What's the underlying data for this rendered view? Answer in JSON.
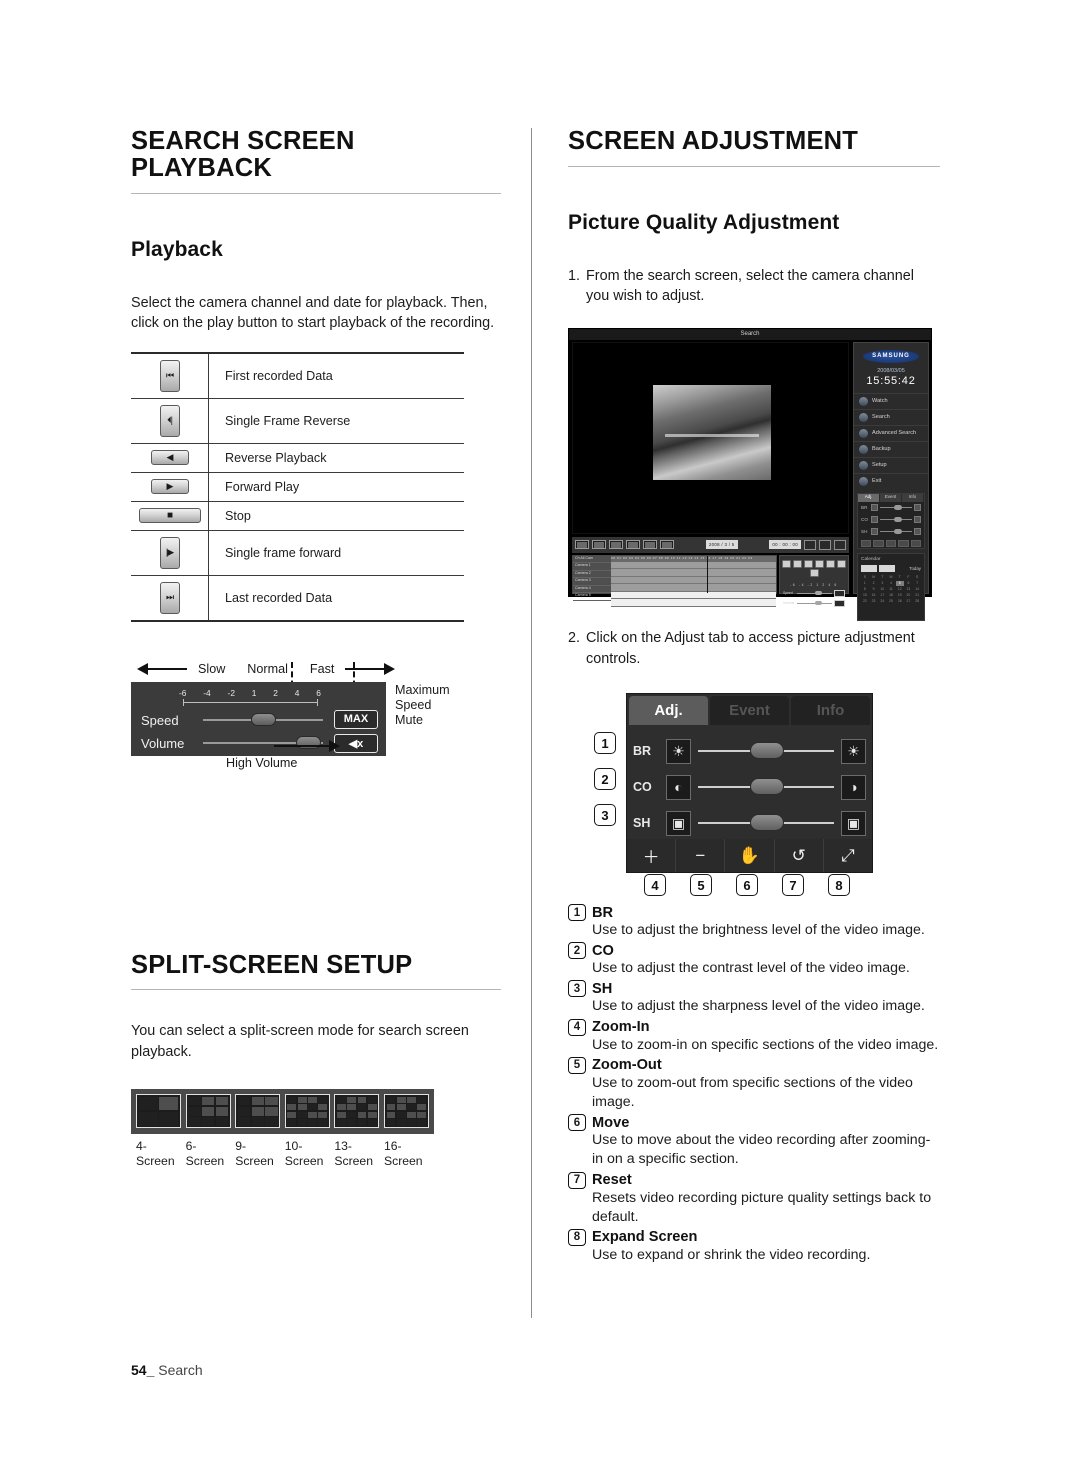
{
  "page": {
    "number": "54",
    "section": "Search",
    "separator": "_"
  },
  "left": {
    "heading": "SEARCH SCREEN PLAYBACK",
    "subheading": "Playback",
    "intro": "Select the camera channel and date for playback. Then, click on the play button to start playback of the recording.",
    "playback_table": [
      {
        "icon": "first-recorded-data-icon",
        "glyph": "⏮",
        "label": "First recorded Data",
        "size": "tall"
      },
      {
        "icon": "single-frame-reverse-icon",
        "glyph": "⏴|",
        "label": "Single Frame Reverse",
        "size": "tall"
      },
      {
        "icon": "reverse-playback-icon",
        "glyph": "◀",
        "label": "Reverse Playback",
        "size": "short"
      },
      {
        "icon": "forward-play-icon",
        "glyph": "▶",
        "label": "Forward Play",
        "size": "short"
      },
      {
        "icon": "stop-icon",
        "glyph": "■",
        "label": "Stop",
        "size": "short"
      },
      {
        "icon": "single-frame-forward-icon",
        "glyph": "|▶",
        "label": "Single frame forward",
        "size": "tall"
      },
      {
        "icon": "last-recorded-data-icon",
        "glyph": "⏭",
        "label": "Last recorded Data",
        "size": "tall"
      }
    ],
    "speed_panel": {
      "label_slow": "Slow",
      "label_normal": "Normal",
      "label_fast": "Fast",
      "ticks": [
        "-6",
        "-4",
        "-2",
        "1",
        "2",
        "4",
        "6"
      ],
      "speed_label": "Speed",
      "volume_label": "Volume",
      "max_button": "MAX",
      "mute_button": "◀x",
      "annot_max": "Maximum\nSpeed",
      "annot_max_line1": "Maximum",
      "annot_max_line2": "Speed",
      "annot_mute": "Mute",
      "annot_high_volume": "High Volume"
    },
    "split_screen": {
      "heading": "SPLIT-SCREEN SETUP",
      "intro": "You can select a split-screen mode for search screen playback.",
      "modes": [
        {
          "label_line1": "4-",
          "label_line2": "Screen",
          "cols": 2,
          "rows": 2
        },
        {
          "label_line1": "6-",
          "label_line2": "Screen",
          "cols": 3,
          "rows": 3
        },
        {
          "label_line1": "9-",
          "label_line2": "Screen",
          "cols": 3,
          "rows": 3
        },
        {
          "label_line1": "10-",
          "label_line2": "Screen",
          "cols": 4,
          "rows": 4
        },
        {
          "label_line1": "13-",
          "label_line2": "Screen",
          "cols": 4,
          "rows": 4
        },
        {
          "label_line1": "16-",
          "label_line2": "Screen",
          "cols": 4,
          "rows": 4
        }
      ]
    }
  },
  "right": {
    "heading": "SCREEN ADJUSTMENT",
    "subheading": "Picture Quality Adjustment",
    "step1_number": "1.",
    "step1_text": "From the search screen, select the camera channel you wish to adjust.",
    "step2_number": "2.",
    "step2_text": "Click on the Adjust tab to access picture adjustment controls.",
    "dvr_screenshot": {
      "window_title": "Search",
      "brand": "SAMSUNG",
      "date": "2008/03/05",
      "time": "15:55:42",
      "menu": [
        "Watch",
        "Search",
        "Advanced Search",
        "Backup",
        "Setup",
        "Exit"
      ],
      "adj_tabs": [
        "Adj.",
        "Event",
        "Info"
      ],
      "adj_keys": [
        "BR",
        "CO",
        "SH"
      ],
      "calendar_label": "Calendar",
      "calendar_today": "Today",
      "calendar_weekdays": [
        "S",
        "M",
        "T",
        "W",
        "T",
        "F",
        "S"
      ],
      "toolbar_date": "2008 / 3 / 5",
      "toolbar_time": "00 : 00 : 00",
      "timeline_channels": [
        "Ch All Cam",
        "Camera 1",
        "Camera 2",
        "Camera 3",
        "Camera 4",
        "Camera 5"
      ],
      "timeline_hours": "00 01 02 03 04 05 06 07 08 09 10 11 12 13 14 15 16 17 18 19 20 21 22 23",
      "speed_label": "Speed",
      "volume_label": "Volume",
      "max_label": "MAX"
    },
    "adj_panel": {
      "tabs": [
        {
          "label": "Adj.",
          "active": true
        },
        {
          "label": "Event",
          "active": false
        },
        {
          "label": "Info",
          "active": false
        }
      ],
      "rows": [
        {
          "num": "1",
          "key": "BR",
          "left_icon": "brightness-icon",
          "left_glyph": "☀",
          "right_icon": "brightness-high-icon",
          "right_glyph": "☀"
        },
        {
          "num": "2",
          "key": "CO",
          "left_icon": "contrast-icon",
          "left_glyph": "◐",
          "right_icon": "contrast-high-icon",
          "right_glyph": "◑"
        },
        {
          "num": "3",
          "key": "SH",
          "left_icon": "sharpness-icon",
          "left_glyph": "▣",
          "right_icon": "sharpness-high-icon",
          "right_glyph": "▣"
        }
      ],
      "bottom_buttons": [
        {
          "num": "4",
          "icon": "zoom-in-plus-icon",
          "glyph": "＋"
        },
        {
          "num": "5",
          "icon": "zoom-out-minus-icon",
          "glyph": "−"
        },
        {
          "num": "6",
          "icon": "hand-move-icon",
          "glyph": "✋"
        },
        {
          "num": "7",
          "icon": "reset-rotate-icon",
          "glyph": "↺"
        },
        {
          "num": "8",
          "icon": "expand-screen-icon",
          "glyph": "⤢"
        }
      ]
    },
    "descriptions": [
      {
        "num": "1",
        "title": "BR",
        "body": "Use to adjust the brightness level of the video image."
      },
      {
        "num": "2",
        "title": "CO",
        "body": "Use to adjust the contrast level of the video image."
      },
      {
        "num": "3",
        "title": "SH",
        "body": "Use to adjust the sharpness level of the video image."
      },
      {
        "num": "4",
        "title": "Zoom-In",
        "body": "Use to zoom-in on specific sections of the video image."
      },
      {
        "num": "5",
        "title": "Zoom-Out",
        "body": "Use to zoom-out from specific sections of the video image."
      },
      {
        "num": "6",
        "title": "Move",
        "body": "Use to move about the video recording after zooming-in on a specific section."
      },
      {
        "num": "7",
        "title": "Reset",
        "body": "Resets video recording picture quality settings back to default."
      },
      {
        "num": "8",
        "title": "Expand Screen",
        "body": "Use to expand or shrink the video recording."
      }
    ]
  }
}
